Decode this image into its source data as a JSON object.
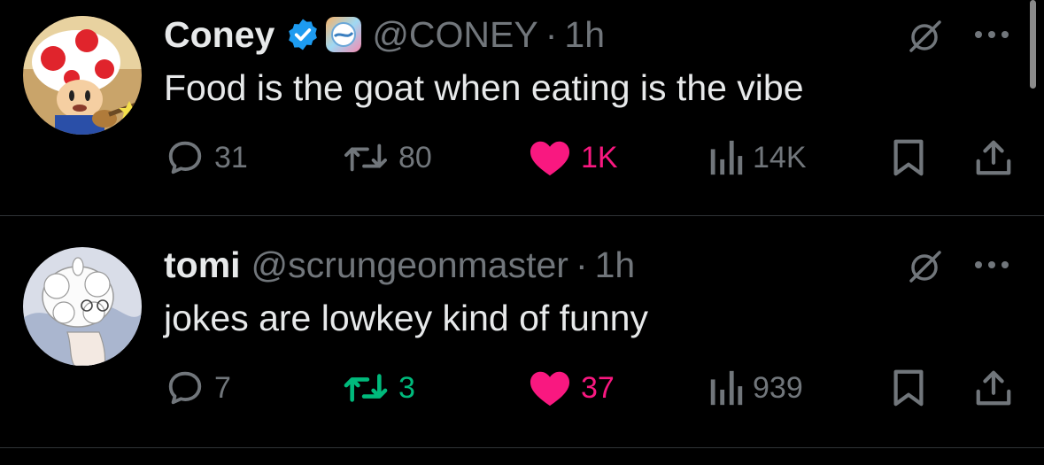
{
  "tweets": [
    {
      "author": {
        "display_name": "Coney",
        "verified": true,
        "affiliate_badge": true,
        "handle": "@CONEY",
        "time": "1h"
      },
      "text": "Food is the goat when eating is the vibe",
      "metrics": {
        "replies": "31",
        "reposts": "80",
        "likes": "1K",
        "views": "14K"
      },
      "liked": true,
      "reposted": false
    },
    {
      "author": {
        "display_name": "tomi",
        "verified": false,
        "affiliate_badge": false,
        "handle": "@scrungeonmaster",
        "time": "1h"
      },
      "text": "jokes are lowkey kind of funny",
      "metrics": {
        "replies": "7",
        "reposts": "3",
        "likes": "37",
        "views": "939"
      },
      "liked": true,
      "reposted": true
    }
  ],
  "separator": "·",
  "colors": {
    "background": "#000000",
    "text": "#e7e9ea",
    "muted": "#71767b",
    "like": "#f91880",
    "repost": "#00ba7c",
    "verified": "#1d9bf0",
    "divider": "#2f3336"
  },
  "icons": [
    "grok-icon",
    "more-icon",
    "reply-icon",
    "repost-icon",
    "like-icon",
    "views-icon",
    "bookmark-icon",
    "share-icon",
    "verified-badge-icon"
  ]
}
